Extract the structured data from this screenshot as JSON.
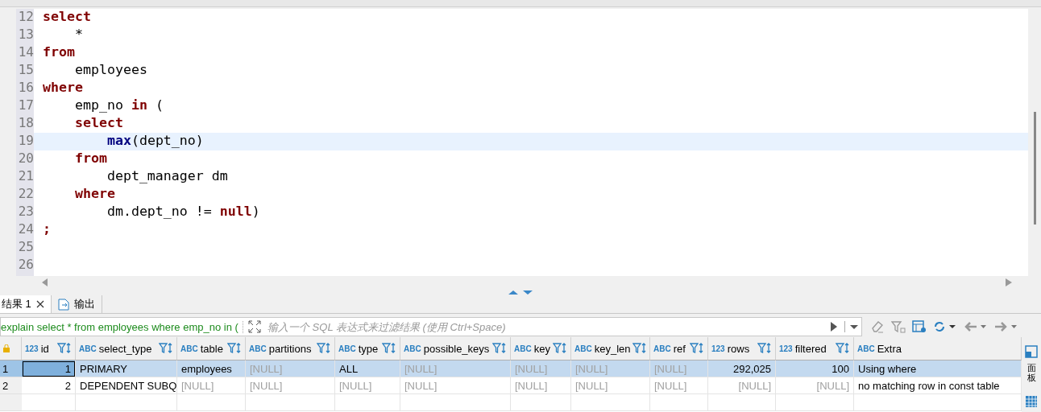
{
  "editor": {
    "lines": [
      {
        "number": "12",
        "current": false,
        "tokens": [
          {
            "kind": "keyword",
            "text": "select"
          }
        ]
      },
      {
        "number": "13",
        "current": false,
        "tokens": [
          {
            "kind": "plain",
            "text": "    *"
          }
        ]
      },
      {
        "number": "14",
        "current": false,
        "tokens": [
          {
            "kind": "keyword",
            "text": "from"
          }
        ]
      },
      {
        "number": "15",
        "current": false,
        "tokens": [
          {
            "kind": "plain",
            "text": "    employees"
          }
        ]
      },
      {
        "number": "16",
        "current": false,
        "tokens": [
          {
            "kind": "keyword",
            "text": "where"
          }
        ]
      },
      {
        "number": "17",
        "current": false,
        "tokens": [
          {
            "kind": "plain",
            "text": "    emp_no "
          },
          {
            "kind": "keyword",
            "text": "in"
          },
          {
            "kind": "plain",
            "text": " ("
          }
        ]
      },
      {
        "number": "18",
        "current": false,
        "tokens": [
          {
            "kind": "keyword",
            "text": "    select"
          }
        ]
      },
      {
        "number": "19",
        "current": true,
        "tokens": [
          {
            "kind": "function",
            "text": "        max"
          },
          {
            "kind": "plain",
            "text": "(dept_no)"
          }
        ]
      },
      {
        "number": "20",
        "current": false,
        "tokens": [
          {
            "kind": "keyword",
            "text": "    from"
          }
        ]
      },
      {
        "number": "21",
        "current": false,
        "tokens": [
          {
            "kind": "plain",
            "text": "        dept_manager dm"
          }
        ]
      },
      {
        "number": "22",
        "current": false,
        "tokens": [
          {
            "kind": "keyword",
            "text": "    where"
          }
        ]
      },
      {
        "number": "23",
        "current": false,
        "tokens": [
          {
            "kind": "plain",
            "text": "        dm.dept_no != "
          },
          {
            "kind": "keyword",
            "text": "null"
          },
          {
            "kind": "plain",
            "text": ")"
          }
        ]
      },
      {
        "number": "24",
        "current": false,
        "tokens": [
          {
            "kind": "keyword",
            "text": ";"
          }
        ]
      },
      {
        "number": "25",
        "current": false
      },
      {
        "number": "26",
        "current": false
      }
    ]
  },
  "result_tabs": [
    {
      "label": "结果 1",
      "selected": true
    },
    {
      "label": "输出",
      "selected": false
    }
  ],
  "filter_bar": {
    "query": "explain select * from employees where emp_no in (",
    "placeholder": "输入一个 SQL 表达式来过滤结果 (使用 Ctrl+Space)"
  },
  "table": {
    "columns": [
      {
        "type": "123",
        "name": "id"
      },
      {
        "type": "ABC",
        "name": "select_type"
      },
      {
        "type": "ABC",
        "name": "table"
      },
      {
        "type": "ABC",
        "name": "partitions"
      },
      {
        "type": "ABC",
        "name": "type"
      },
      {
        "type": "ABC",
        "name": "possible_keys"
      },
      {
        "type": "ABC",
        "name": "key"
      },
      {
        "type": "ABC",
        "name": "key_len"
      },
      {
        "type": "ABC",
        "name": "ref"
      },
      {
        "type": "123",
        "name": "rows"
      },
      {
        "type": "123",
        "name": "filtered"
      },
      {
        "type": "ABC",
        "name": "Extra"
      }
    ],
    "rows": [
      {
        "number": "1",
        "selected": true,
        "cells": [
          {
            "text": "1",
            "null": false,
            "focused": true
          },
          {
            "text": "PRIMARY",
            "null": false,
            "focused": false
          },
          {
            "text": "employees",
            "null": false,
            "focused": false
          },
          {
            "text": "[NULL]",
            "null": true,
            "focused": false
          },
          {
            "text": "ALL",
            "null": false,
            "focused": false
          },
          {
            "text": "[NULL]",
            "null": true,
            "focused": false
          },
          {
            "text": "[NULL]",
            "null": true,
            "focused": false
          },
          {
            "text": "[NULL]",
            "null": true,
            "focused": false
          },
          {
            "text": "[NULL]",
            "null": true,
            "focused": false
          },
          {
            "text": "292,025",
            "null": false,
            "focused": false
          },
          {
            "text": "100",
            "null": false,
            "focused": false
          },
          {
            "text": "Using where",
            "null": false,
            "focused": false
          }
        ]
      },
      {
        "number": "2",
        "selected": false,
        "cells": [
          {
            "text": "2",
            "null": false,
            "focused": false
          },
          {
            "text": "DEPENDENT SUBQ",
            "null": false,
            "focused": false
          },
          {
            "text": "[NULL]",
            "null": true,
            "focused": false
          },
          {
            "text": "[NULL]",
            "null": true,
            "focused": false
          },
          {
            "text": "[NULL]",
            "null": true,
            "focused": false
          },
          {
            "text": "[NULL]",
            "null": true,
            "focused": false
          },
          {
            "text": "[NULL]",
            "null": true,
            "focused": false
          },
          {
            "text": "[NULL]",
            "null": true,
            "focused": false
          },
          {
            "text": "[NULL]",
            "null": true,
            "focused": false
          },
          {
            "text": "[NULL]",
            "null": true,
            "focused": false
          },
          {
            "text": "[NULL]",
            "null": true,
            "focused": false
          },
          {
            "text": "no matching row in const table",
            "null": false,
            "focused": false
          }
        ]
      }
    ]
  },
  "side_panel": {
    "label": "面板"
  }
}
